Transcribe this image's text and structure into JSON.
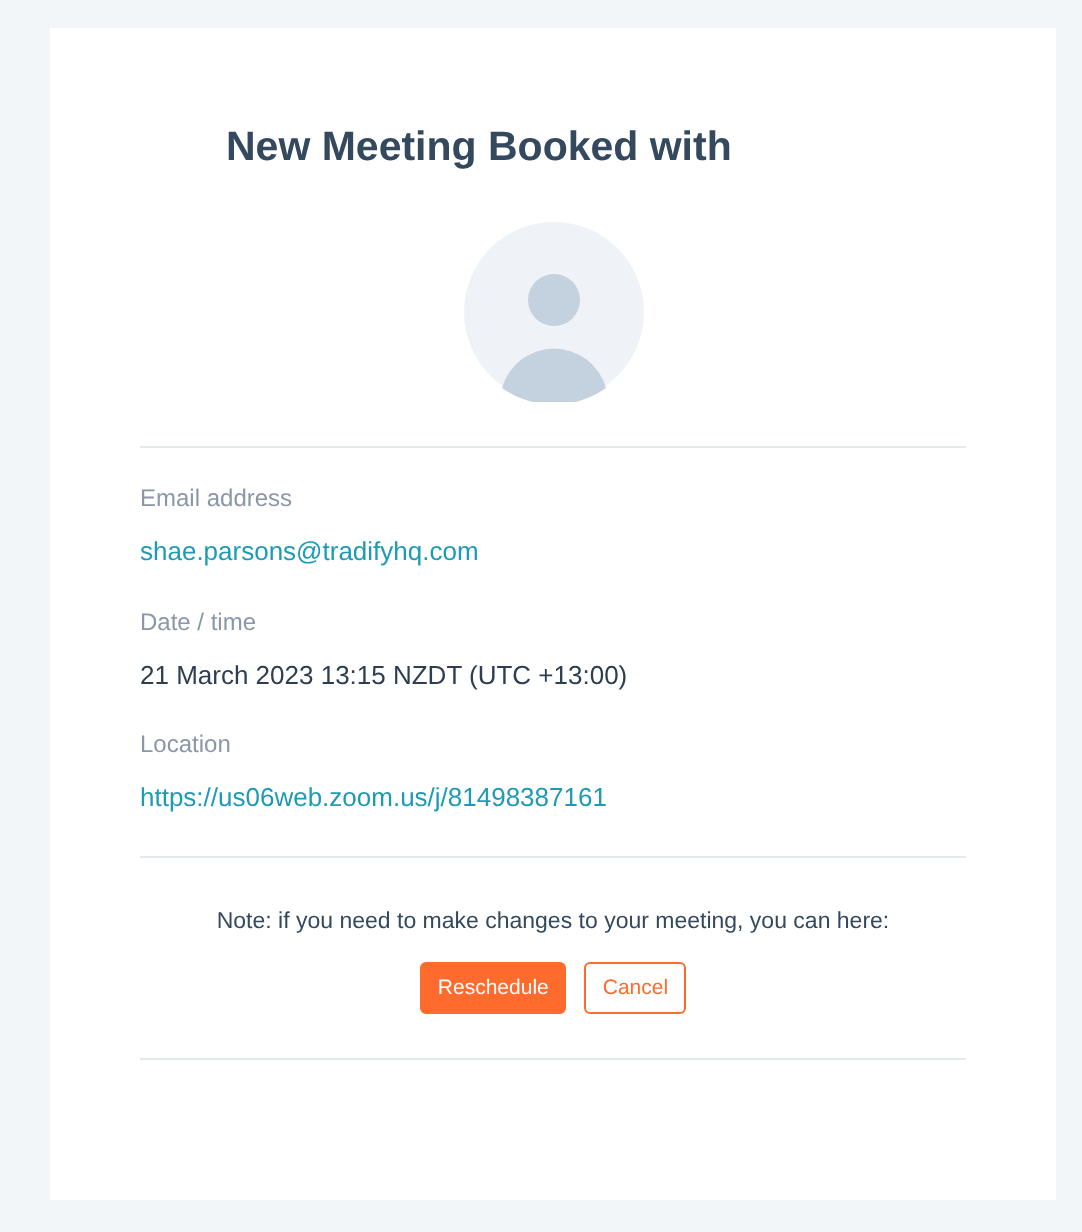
{
  "title": "New Meeting Booked with",
  "fields": [
    {
      "label": "Email address",
      "value": "shae.parsons@tradifyhq.com",
      "kind": "link"
    },
    {
      "label": "Date / time",
      "value": "21 March 2023 13:15 NZDT (UTC +13:00)",
      "kind": "text"
    },
    {
      "label": "Location",
      "value": "https://us06web.zoom.us/j/81498387161",
      "kind": "link"
    }
  ],
  "note": "Note: if you need to make changes to your meeting, you can here:",
  "buttons": [
    {
      "label": "Reschedule",
      "kind": "primary"
    },
    {
      "label": "Cancel",
      "kind": "outline"
    }
  ]
}
